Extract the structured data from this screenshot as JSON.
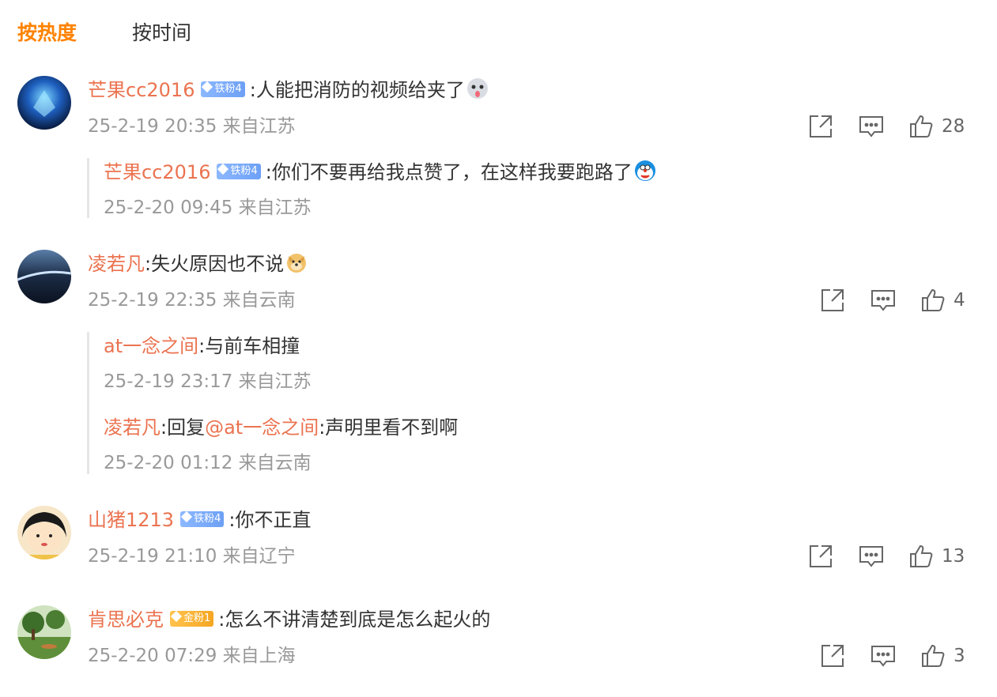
{
  "tabs": {
    "hot": "按热度",
    "time": "按时间"
  },
  "icons": {
    "share": "share-icon",
    "comment": "comment-icon",
    "like": "thumbs-up-icon"
  },
  "colors": {
    "accent": "#ff8200",
    "username": "#eb7350",
    "meta": "#999999",
    "iron_badge": "#7aa9fa",
    "gold_badge": "#f5b02f"
  },
  "comments": [
    {
      "user": "芒果cc2016",
      "badge": "铁粉4",
      "text": ":人能把消防的视频给夹了",
      "time": "25-2-19 20:35 来自江苏",
      "likes": "28",
      "replies": [
        {
          "user": "芒果cc2016",
          "badge": "铁粉4",
          "text": ":你们不要再给我点赞了，在这样我要跑路了",
          "time": "25-2-20 09:45 来自江苏"
        }
      ]
    },
    {
      "user": "凌若凡",
      "text": ":失火原因也不说",
      "time": "25-2-19 22:35 来自云南",
      "likes": "4",
      "replies": [
        {
          "user": "at一念之间",
          "text": ":与前车相撞",
          "time": "25-2-19 23:17 来自江苏"
        },
        {
          "user": "凌若凡",
          "text_pre": ":回复",
          "mention": "@at一念之间",
          "text": ":声明里看不到啊",
          "time": "25-2-20 01:12 来自云南"
        }
      ]
    },
    {
      "user": "山猪1213",
      "badge": "铁粉4",
      "text": ":你不正直",
      "time": "25-2-19 21:10 来自辽宁",
      "likes": "13"
    },
    {
      "user": "肯思必克",
      "badge": "金粉1",
      "text": ":怎么不讲清楚到底是怎么起火的",
      "time": "25-2-20 07:29 来自上海",
      "likes": "3"
    }
  ]
}
